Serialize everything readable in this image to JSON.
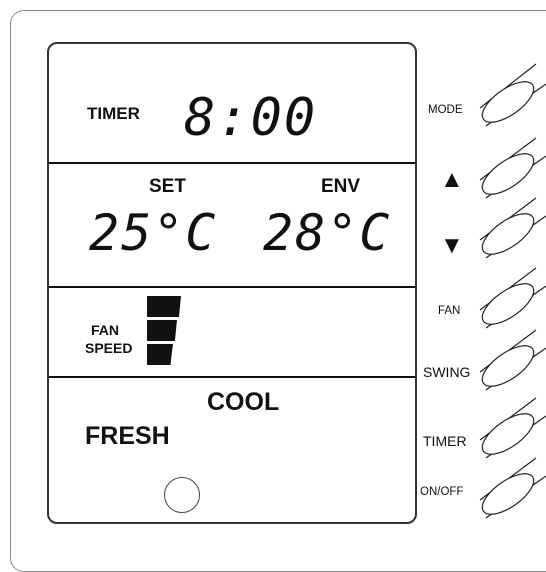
{
  "display": {
    "timer_label": "TIMER",
    "timer_value": "8:00",
    "set_label": "SET",
    "set_temp": "25°C",
    "env_label": "ENV",
    "env_temp": "28°C",
    "fan_speed_label_1": "FAN",
    "fan_speed_label_2": "SPEED",
    "mode_text": "COOL",
    "fresh_text": "FRESH"
  },
  "buttons": {
    "mode": "MODE",
    "up": "▲",
    "down": "▼",
    "fan": "FAN",
    "swing": "SWING",
    "timer": "TIMER",
    "onoff": "ON/OFF"
  },
  "icons": {
    "fan_speed": "fan-speed-bars-icon",
    "sensor": "sensor-circle-icon",
    "up": "triangle-up-icon",
    "down": "triangle-down-icon"
  }
}
